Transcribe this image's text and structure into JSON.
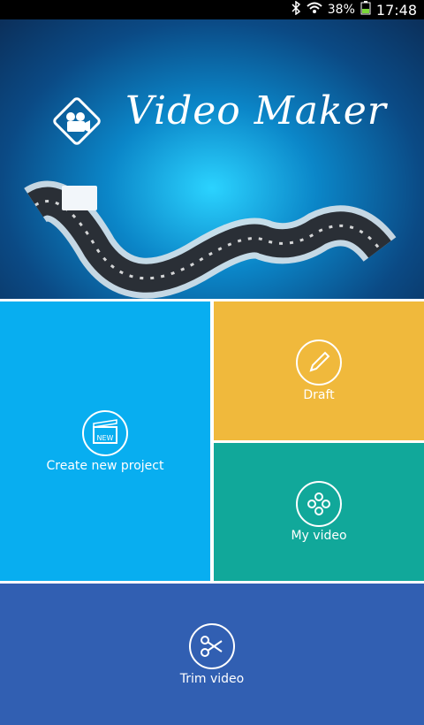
{
  "status_bar": {
    "battery_percent": "38%",
    "time": "17:48",
    "icons": [
      "bluetooth-icon",
      "wifi-icon",
      "battery-icon"
    ]
  },
  "banner": {
    "title": "Video Maker",
    "logo_icon": "video-camera-icon",
    "background_color": "#0b86c8"
  },
  "tiles": {
    "create": {
      "label": "Create new project",
      "badge_text": "NEW",
      "icon": "clapperboard-icon",
      "color": "#08aef0"
    },
    "draft": {
      "label": "Draft",
      "icon": "pencil-icon",
      "color": "#f0b93c"
    },
    "my_video": {
      "label": "My video",
      "icon": "film-reel-icon",
      "color": "#11a89a"
    },
    "trim": {
      "label": "Trim video",
      "icon": "scissors-icon",
      "color": "#315fb2"
    }
  }
}
